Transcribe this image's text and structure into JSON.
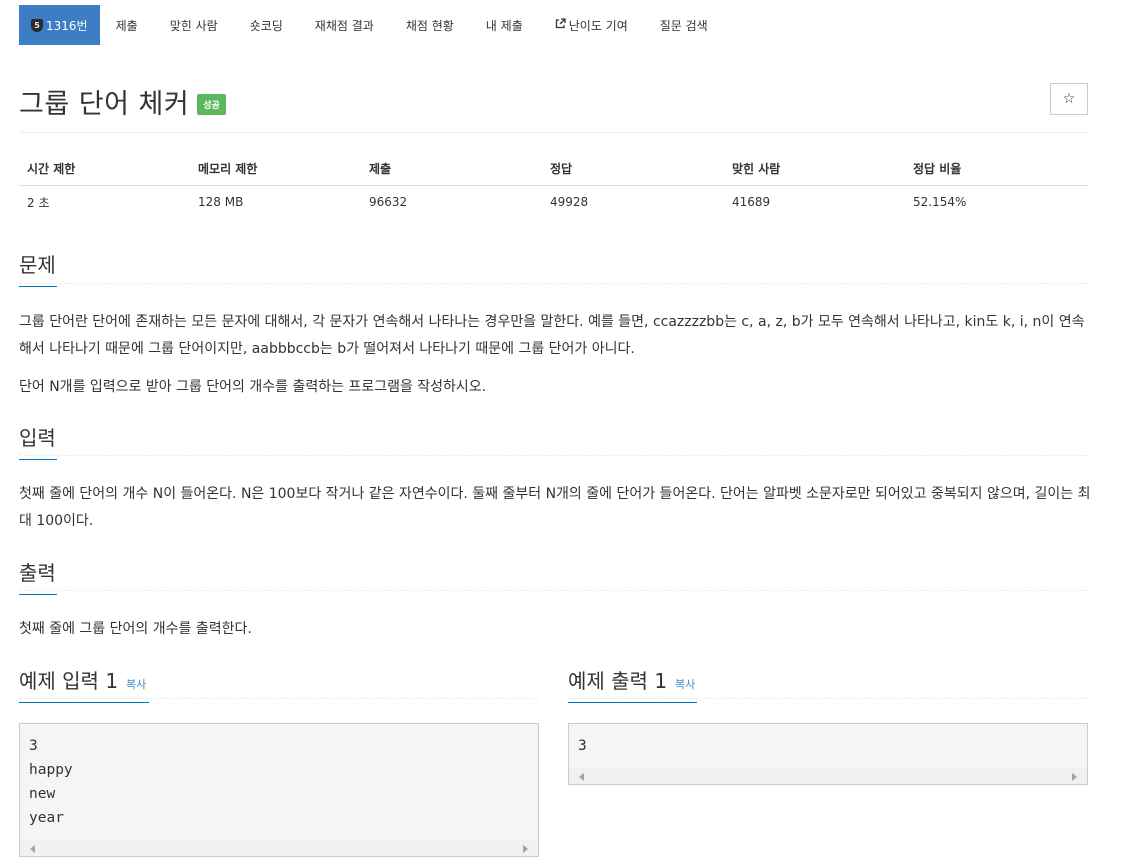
{
  "nav": {
    "tier_number": "5",
    "items": [
      "1316번",
      "제출",
      "맞힌 사람",
      "숏코딩",
      "재채점 결과",
      "채점 현황",
      "내 제출",
      "난이도 기여",
      "질문 검색"
    ]
  },
  "problem": {
    "title": "그룹 단어 체커",
    "status": "성공",
    "star_glyph": "☆"
  },
  "info_table": {
    "headers": [
      "시간 제한",
      "메모리 제한",
      "제출",
      "정답",
      "맞힌 사람",
      "정답 비율"
    ],
    "values": [
      "2 초",
      "128 MB",
      "96632",
      "49928",
      "41689",
      "52.154%"
    ]
  },
  "sections": {
    "description": {
      "heading": "문제",
      "p1": "그룹 단어란 단어에 존재하는 모든 문자에 대해서, 각 문자가 연속해서 나타나는 경우만을 말한다. 예를 들면, ccazzzzbb는 c, a, z, b가 모두 연속해서 나타나고, kin도 k, i, n이 연속해서 나타나기 때문에 그룹 단어이지만, aabbbccb는 b가 떨어져서 나타나기 때문에 그룹 단어가 아니다.",
      "p2": "단어 N개를 입력으로 받아 그룹 단어의 개수를 출력하는 프로그램을 작성하시오."
    },
    "input": {
      "heading": "입력",
      "p1": "첫째 줄에 단어의 개수 N이 들어온다. N은 100보다 작거나 같은 자연수이다. 둘째 줄부터 N개의 줄에 단어가 들어온다. 단어는 알파벳 소문자로만 되어있고 중복되지 않으며, 길이는 최대 100이다."
    },
    "output": {
      "heading": "출력",
      "p1": "첫째 줄에 그룹 단어의 개수를 출력한다."
    }
  },
  "samples": {
    "input": {
      "heading": "예제 입력 1",
      "copy_label": "복사",
      "text": "3\nhappy\nnew\nyear"
    },
    "output": {
      "heading": "예제 출력 1",
      "copy_label": "복사",
      "text": "3"
    }
  },
  "colors": {
    "nav_active": "#3c7dc4",
    "status_success": "#5cb85c",
    "heading_underline": "#0076c0",
    "copy_link": "#428bca"
  }
}
